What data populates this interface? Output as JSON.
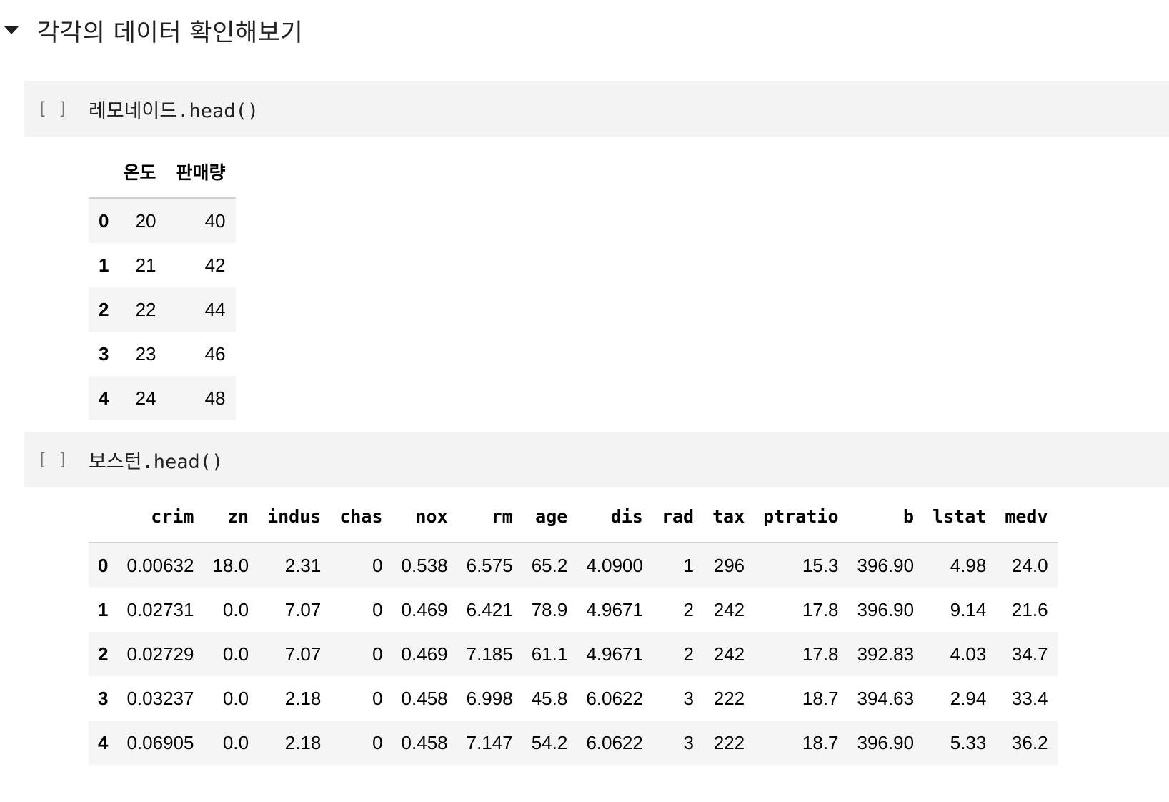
{
  "section": {
    "title": "각각의 데이터 확인해보기"
  },
  "cells": [
    {
      "bracket": "[ ]",
      "code": "레모네이드.head()",
      "table": {
        "columns": [
          "",
          "온도",
          "판매량"
        ],
        "rows": [
          [
            "0",
            "20",
            "40"
          ],
          [
            "1",
            "21",
            "42"
          ],
          [
            "2",
            "22",
            "44"
          ],
          [
            "3",
            "23",
            "46"
          ],
          [
            "4",
            "24",
            "48"
          ]
        ]
      }
    },
    {
      "bracket": "[ ]",
      "code": "보스턴.head()",
      "table": {
        "columns": [
          "",
          "crim",
          "zn",
          "indus",
          "chas",
          "nox",
          "rm",
          "age",
          "dis",
          "rad",
          "tax",
          "ptratio",
          "b",
          "lstat",
          "medv"
        ],
        "rows": [
          [
            "0",
            "0.00632",
            "18.0",
            "2.31",
            "0",
            "0.538",
            "6.575",
            "65.2",
            "4.0900",
            "1",
            "296",
            "15.3",
            "396.90",
            "4.98",
            "24.0"
          ],
          [
            "1",
            "0.02731",
            "0.0",
            "7.07",
            "0",
            "0.469",
            "6.421",
            "78.9",
            "4.9671",
            "2",
            "242",
            "17.8",
            "396.90",
            "9.14",
            "21.6"
          ],
          [
            "2",
            "0.02729",
            "0.0",
            "7.07",
            "0",
            "0.469",
            "7.185",
            "61.1",
            "4.9671",
            "2",
            "242",
            "17.8",
            "392.83",
            "4.03",
            "34.7"
          ],
          [
            "3",
            "0.03237",
            "0.0",
            "2.18",
            "0",
            "0.458",
            "6.998",
            "45.8",
            "6.0622",
            "3",
            "222",
            "18.7",
            "394.63",
            "2.94",
            "33.4"
          ],
          [
            "4",
            "0.06905",
            "0.0",
            "2.18",
            "0",
            "0.458",
            "7.147",
            "54.2",
            "6.0622",
            "3",
            "222",
            "18.7",
            "396.90",
            "5.33",
            "36.2"
          ]
        ]
      }
    }
  ]
}
